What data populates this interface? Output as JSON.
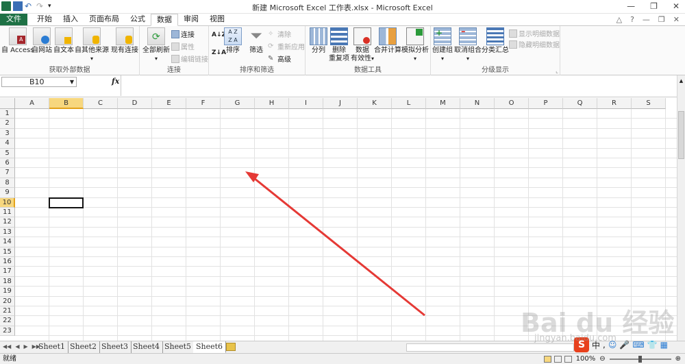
{
  "window": {
    "title": "新建 Microsoft Excel 工作表.xlsx - Microsoft Excel",
    "controls": [
      "—",
      "❐",
      "✕"
    ]
  },
  "tabs": [
    {
      "label": "文件",
      "type": "file"
    },
    {
      "label": "开始"
    },
    {
      "label": "插入"
    },
    {
      "label": "页面布局"
    },
    {
      "label": "公式"
    },
    {
      "label": "数据",
      "active": true
    },
    {
      "label": "审阅"
    },
    {
      "label": "视图"
    }
  ],
  "ribbon": {
    "groups": {
      "external": {
        "label": "获取外部数据",
        "buttons": [
          "自 Access",
          "自网站",
          "自文本",
          "自其他来源",
          "现有连接"
        ]
      },
      "connections": {
        "label": "连接",
        "refresh_all": "全部刷新",
        "connections": "连接",
        "properties": "属性",
        "edit_links": "编辑链接"
      },
      "sort_filter": {
        "label": "排序和筛选",
        "sort": "排序",
        "filter": "筛选",
        "clear": "清除",
        "reapply": "重新应用",
        "advanced": "高级"
      },
      "data_tools": {
        "label": "数据工具",
        "text_to_columns": "分列",
        "remove_duplicates_1": "删除",
        "remove_duplicates_2": "重复项",
        "validation_1": "数据",
        "validation_2": "有效性",
        "consolidate": "合并计算",
        "what_if": "模拟分析"
      },
      "outline": {
        "label": "分级显示",
        "group": "创建组",
        "ungroup": "取消组合",
        "subtotal": "分类汇总",
        "show_detail": "显示明细数据",
        "hide_detail": "隐藏明细数据"
      }
    }
  },
  "formula_bar": {
    "name_box": "B10",
    "fx": "fx",
    "formula": ""
  },
  "grid": {
    "columns": [
      "A",
      "B",
      "C",
      "D",
      "E",
      "F",
      "G",
      "H",
      "I",
      "J",
      "K",
      "L",
      "M",
      "N",
      "O",
      "P",
      "Q",
      "R",
      "S"
    ],
    "selected_column": "B",
    "rows": [
      "1",
      "2",
      "3",
      "4",
      "5",
      "6",
      "7",
      "8",
      "9",
      "10",
      "11",
      "12",
      "13",
      "14",
      "15",
      "16",
      "17",
      "18",
      "19",
      "20",
      "21",
      "22",
      "23"
    ],
    "selected_row": "10",
    "selected_cell": "B10"
  },
  "sheets": [
    "Sheet1",
    "Sheet2",
    "Sheet3",
    "Sheet4",
    "Sheet5",
    "Sheet6"
  ],
  "active_sheet": "Sheet6",
  "status": {
    "ready": "就绪",
    "zoom": "100%"
  },
  "watermark": {
    "text": "Bai du 经验",
    "sub": "jingyan.baidu.com"
  },
  "ime": {
    "label": "S",
    "lang": "中"
  },
  "colors": {
    "file_tab": "#1e7145",
    "selection_header": "#f7d77e",
    "arrow": "#e53935"
  }
}
